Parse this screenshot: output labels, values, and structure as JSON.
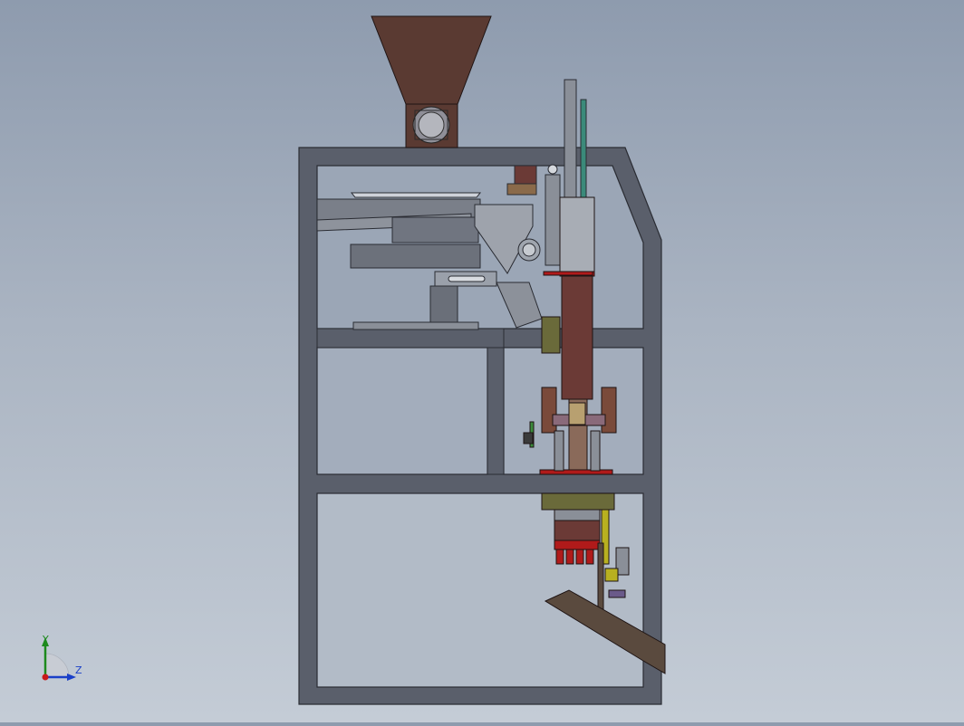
{
  "viewport": {
    "background_top": "#8e9bae",
    "background_bottom": "#c4ccd6"
  },
  "triad": {
    "y_label": "Y",
    "z_label": "Z",
    "y_color": "#1d8a1d",
    "z_color": "#1a3fc8",
    "origin_color": "#c81a1a"
  },
  "model": {
    "frame_color": "#5a5f6b",
    "hopper_color": "#5a3a32",
    "column_color": "#6b3a36",
    "chute_color": "#5a4a3e",
    "accent_red": "#b01a1a",
    "accent_teal": "#3a8a7a",
    "accent_olive": "#6a6a3a",
    "accent_yellow": "#b8b020"
  }
}
